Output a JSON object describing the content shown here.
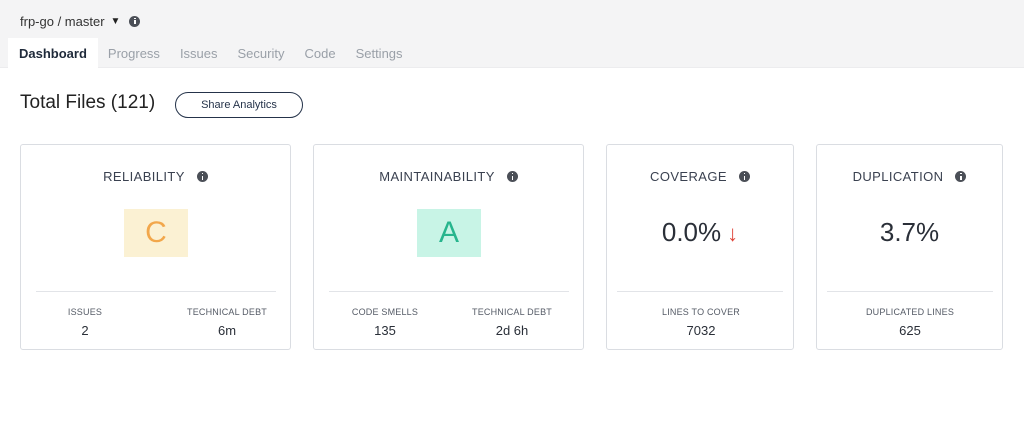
{
  "header": {
    "repo": "frp-go / master",
    "tabs": [
      {
        "label": "Dashboard",
        "active": true
      },
      {
        "label": "Progress",
        "active": false
      },
      {
        "label": "Issues",
        "active": false
      },
      {
        "label": "Security",
        "active": false
      },
      {
        "label": "Code",
        "active": false
      },
      {
        "label": "Settings",
        "active": false
      }
    ]
  },
  "page": {
    "title": "Total Files (121)",
    "share_label": "Share Analytics"
  },
  "cards": {
    "reliability": {
      "title": "RELIABILITY",
      "rating": "C",
      "rating_bg": "#fbf1d3",
      "rating_color": "#f2a74b",
      "metrics": [
        {
          "label": "ISSUES",
          "value": "2"
        },
        {
          "label": "TECHNICAL DEBT",
          "value": "6m"
        }
      ]
    },
    "maintainability": {
      "title": "MAINTAINABILITY",
      "rating": "A",
      "rating_bg": "#c8f4e6",
      "rating_color": "#27b58d",
      "metrics": [
        {
          "label": "CODE SMELLS",
          "value": "135"
        },
        {
          "label": "TECHNICAL DEBT",
          "value": "2d 6h"
        }
      ]
    },
    "coverage": {
      "title": "COVERAGE",
      "value": "0.0%",
      "trend_icon": "down-arrow",
      "trend_symbol": "↓",
      "trend_color": "#e0463b",
      "metrics": [
        {
          "label": "LINES TO COVER",
          "value": "7032"
        }
      ]
    },
    "duplication": {
      "title": "DUPLICATION",
      "value": "3.7%",
      "metrics": [
        {
          "label": "DUPLICATED LINES",
          "value": "625"
        }
      ]
    }
  }
}
